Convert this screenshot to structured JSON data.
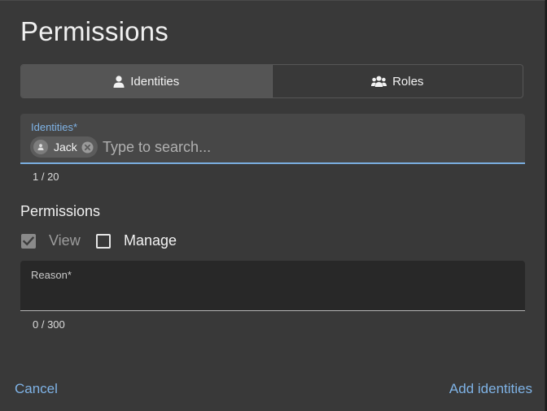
{
  "dialog": {
    "title": "Permissions"
  },
  "tabs": [
    {
      "label": "Identities",
      "icon": "person-icon",
      "active": true
    },
    {
      "label": "Roles",
      "icon": "people-group-icon",
      "active": false
    }
  ],
  "identities_field": {
    "label": "Identities",
    "required_mark": "*",
    "chips": [
      {
        "label": "Jack",
        "icon": "person-icon"
      }
    ],
    "placeholder": "Type to search...",
    "value": "",
    "counter": "1 / 20"
  },
  "permissions": {
    "heading": "Permissions",
    "options": [
      {
        "label": "View",
        "checked": true,
        "disabled": true
      },
      {
        "label": "Manage",
        "checked": false,
        "disabled": false
      }
    ]
  },
  "reason_field": {
    "label": "Reason",
    "required_mark": "*",
    "value": "",
    "counter": "0 / 300"
  },
  "footer": {
    "cancel_label": "Cancel",
    "submit_label": "Add identities"
  },
  "colors": {
    "accent": "#7fb3e6",
    "dialog_bg": "#393939",
    "field_bg": "#474747",
    "reason_bg": "#282828"
  }
}
